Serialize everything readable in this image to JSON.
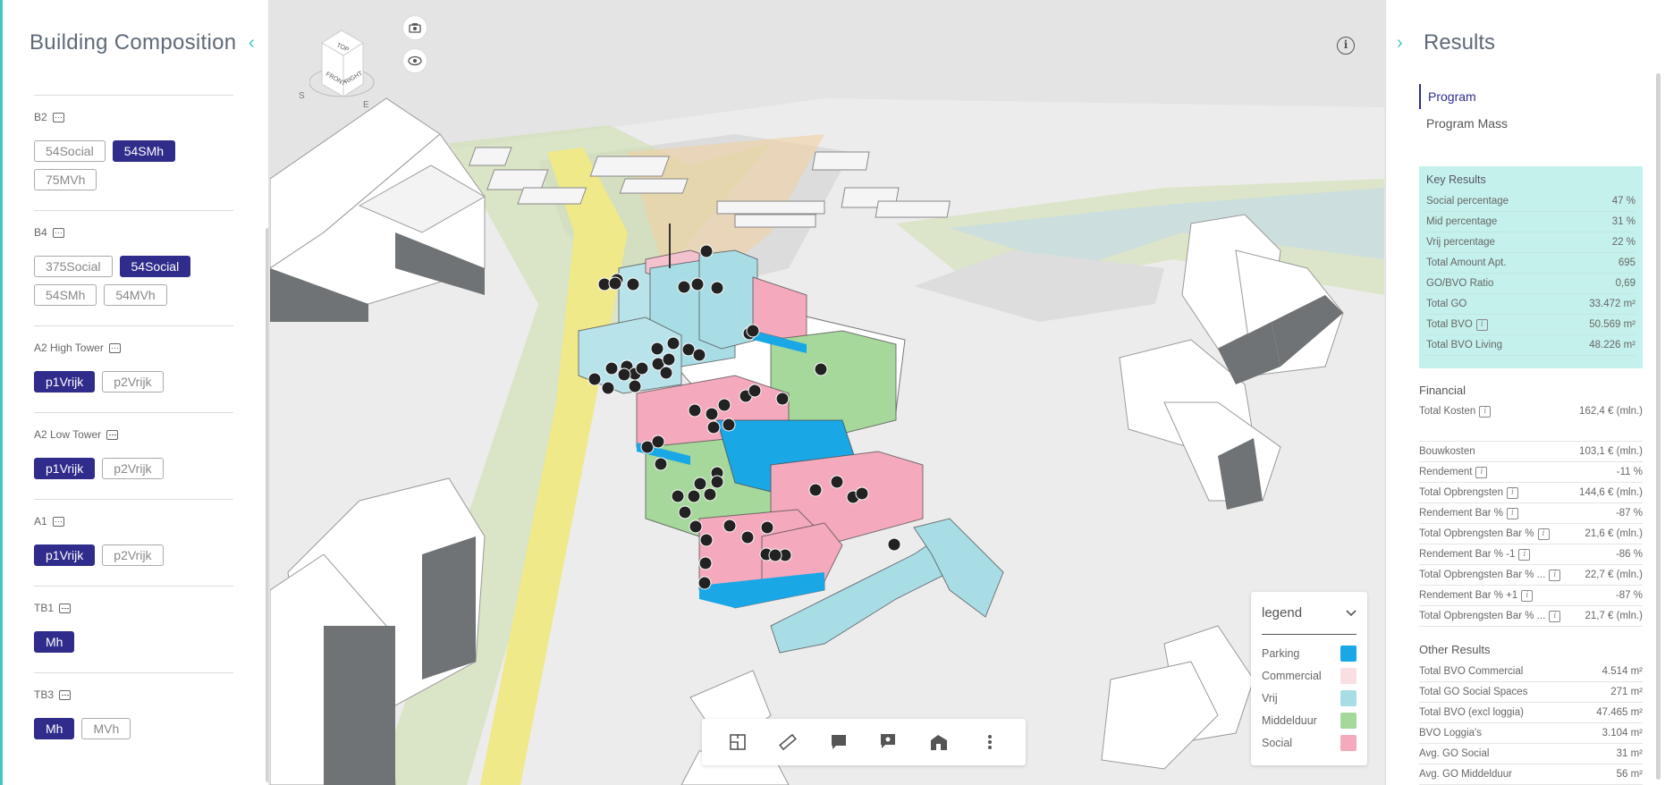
{
  "left_panel": {
    "title": "Building Composition",
    "sections": [
      {
        "name": "B2",
        "chips": [
          {
            "label": "54Social",
            "active": false
          },
          {
            "label": "54SMh",
            "active": true
          },
          {
            "label": "75MVh",
            "active": false
          }
        ]
      },
      {
        "name": "B4",
        "chips": [
          {
            "label": "375Social",
            "active": false
          },
          {
            "label": "54Social",
            "active": true
          },
          {
            "label": "54SMh",
            "active": false
          },
          {
            "label": "54MVh",
            "active": false
          }
        ]
      },
      {
        "name": "A2 High Tower",
        "chips": [
          {
            "label": "p1Vrijk",
            "active": true
          },
          {
            "label": "p2Vrijk",
            "active": false
          }
        ]
      },
      {
        "name": "A2 Low Tower",
        "chips": [
          {
            "label": "p1Vrijk",
            "active": true
          },
          {
            "label": "p2Vrijk",
            "active": false
          }
        ]
      },
      {
        "name": "A1",
        "chips": [
          {
            "label": "p1Vrijk",
            "active": true
          },
          {
            "label": "p2Vrijk",
            "active": false
          }
        ]
      },
      {
        "name": "TB1",
        "chips": [
          {
            "label": "Mh",
            "active": true
          }
        ]
      },
      {
        "name": "TB3",
        "chips": [
          {
            "label": "Mh",
            "active": true
          },
          {
            "label": "MVh",
            "active": false
          }
        ]
      }
    ]
  },
  "viewport": {
    "nav_cube": {
      "top": "TOP",
      "front": "FRONT",
      "right": "RIGHT"
    },
    "compass": {
      "s": "S",
      "e": "E"
    },
    "toolbar_icons": [
      "floorplan-icon",
      "ruler-icon",
      "comment-icon",
      "view-comment-icon",
      "building-icon",
      "more-icon"
    ]
  },
  "legend": {
    "title": "legend",
    "items": [
      {
        "label": "Parking",
        "color": "#1aa7e6"
      },
      {
        "label": "Commercial",
        "color": "#f9dfe1"
      },
      {
        "label": "Vrij",
        "color": "#a9dde6"
      },
      {
        "label": "Middelduur",
        "color": "#a6d79b"
      },
      {
        "label": "Social",
        "color": "#f4a9bd"
      }
    ]
  },
  "right_panel": {
    "title": "Results",
    "tabs": [
      {
        "label": "Program",
        "active": true
      },
      {
        "label": "Program Mass",
        "active": false
      }
    ],
    "key_results": {
      "title": "Key Results",
      "rows": [
        {
          "label": "Social percentage",
          "value": "47 %"
        },
        {
          "label": "Mid percentage",
          "value": "31 %"
        },
        {
          "label": "Vrij percentage",
          "value": "22 %"
        },
        {
          "label": "Total Amount Apt.",
          "value": "695"
        },
        {
          "label": "GO/BVO Ratio",
          "value": "0,69"
        },
        {
          "label": "Total GO",
          "value": "33.472 m²"
        },
        {
          "label": "Total BVO",
          "value": "50.569 m²",
          "info": true
        },
        {
          "label": "Total BVO Living",
          "value": "48.226 m²"
        }
      ]
    },
    "financial": {
      "title": "Financial",
      "rows": [
        {
          "label": "Total Kosten",
          "value": "162,4 € (mln.)",
          "info": true
        },
        {
          "label": "Bouwkosten",
          "value": "103,1 € (mln.)"
        },
        {
          "label": "Rendement",
          "value": "-11 %",
          "info": true
        },
        {
          "label": "Total Opbrengsten",
          "value": "144,6 € (mln.)",
          "info": true
        },
        {
          "label": "Rendement Bar %",
          "value": "-87 %",
          "info": true
        },
        {
          "label": "Total Opbrengsten Bar %",
          "value": "21,6 € (mln.)",
          "info": true
        },
        {
          "label": "Rendement Bar % -1",
          "value": "-86 %",
          "info": true
        },
        {
          "label": "Total Opbrengsten Bar % ...",
          "value": "22,7 € (mln.)",
          "info": true
        },
        {
          "label": "Rendement Bar % +1",
          "value": "-87 %",
          "info": true
        },
        {
          "label": "Total Opbrengsten Bar % ...",
          "value": "21,7 € (mln.)",
          "info": true
        }
      ]
    },
    "other": {
      "title": "Other Results",
      "rows": [
        {
          "label": "Total BVO Commercial",
          "value": "4.514 m²"
        },
        {
          "label": "Total GO Social Spaces",
          "value": "271 m²"
        },
        {
          "label": "Total BVO (excl loggia)",
          "value": "47.465 m²"
        },
        {
          "label": "BVO Loggia's",
          "value": "3.104 m²"
        },
        {
          "label": "Avg. GO Social",
          "value": "31 m²"
        },
        {
          "label": "Avg. GO Middelduur",
          "value": "56 m²"
        }
      ]
    }
  }
}
